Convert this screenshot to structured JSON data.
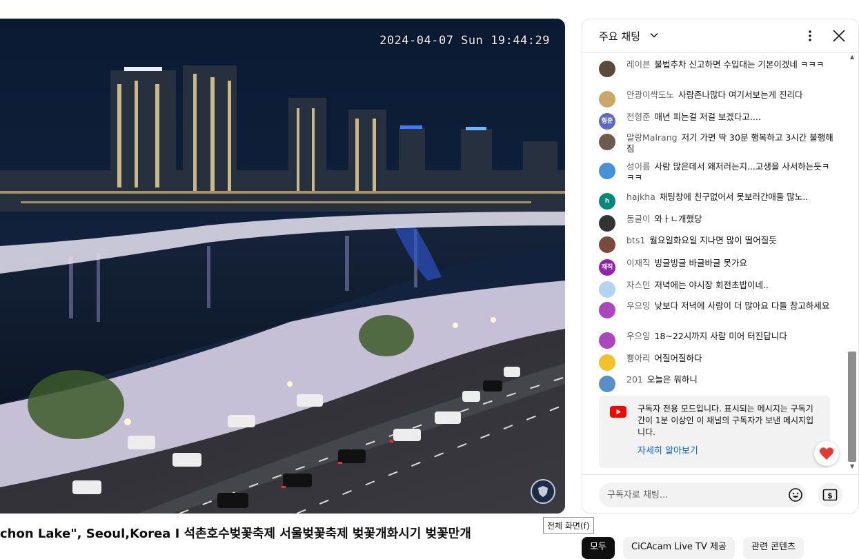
{
  "video": {
    "timestamp": "2024-04-07 Sun 19:44:29",
    "title": "chon Lake\", Seoul,Korea I 석촌호수벚꽃축제 서울벚꽃축제 벚꽃개화시기 벚꽃만개",
    "fullscreen_tooltip": "전체 화면(f)"
  },
  "chat": {
    "header_title": "주요 채팅",
    "messages": [
      {
        "author": "레이븐",
        "text": "불법추차 신고하면 수입대는 기본이겠네 ㅋㅋㅋ",
        "avatar_color": "#5a4a3a",
        "avatar_text": ""
      },
      {
        "author": "안광이싹도노",
        "text": "사람존나많다 여기서보는게 진리다",
        "avatar_color": "#c9a86a",
        "avatar_text": ""
      },
      {
        "author": "전형준",
        "text": "매년 피는걸 저걸 보겠다고....",
        "avatar_color": "#5c6bc0",
        "avatar_text": "형준"
      },
      {
        "author": "말랑Malrang",
        "text": "저기 가면 딱 30분 행복하고 3시간 불행해짐",
        "avatar_color": "#6b5a4e",
        "avatar_text": ""
      },
      {
        "author": "성이름",
        "text": "사람 많은데서 왜저러는지...고생을 사서하는듯ㅋㅋㅋ",
        "avatar_color": "#4a90d9",
        "avatar_text": ""
      },
      {
        "author": "hajkha",
        "text": "채팅창에 친구없어서 못보러간애들 많노..",
        "avatar_color": "#00897b",
        "avatar_text": "h"
      },
      {
        "author": "동글이",
        "text": "와ㅏㄴ개했당",
        "avatar_color": "#333333",
        "avatar_text": ""
      },
      {
        "author": "bts1",
        "text": "월요일화요일 지나면 많이 떨어질듯",
        "avatar_color": "#7a4a3a",
        "avatar_text": ""
      },
      {
        "author": "이재직",
        "text": "빙글빙글 바글바글 못가요",
        "avatar_color": "#8e24aa",
        "avatar_text": "재직"
      },
      {
        "author": "자스민",
        "text": "저녁에는 야시장 회전초밥이네..",
        "avatar_color": "#b3d4f0",
        "avatar_text": ""
      },
      {
        "author": "우으잉",
        "text": "낮보다 저녁에 사람이 더 많아요 다들 참고하세요",
        "avatar_color": "#ab47bc",
        "avatar_text": ""
      },
      {
        "author": "우으잉",
        "text": "18~22시까지 사람 미어 터진답니다",
        "avatar_color": "#ab47bc",
        "avatar_text": ""
      },
      {
        "author": "뿅아리",
        "text": "어질어질하다",
        "avatar_color": "#f2c12e",
        "avatar_text": ""
      },
      {
        "author": "201",
        "text": "오늘은 뭐하니",
        "avatar_color": "#5a8ec9",
        "avatar_text": ""
      }
    ],
    "notice_text": "구독자 전용 모드입니다. 표시되는 메시지는 구독기간이 1분 이상인 이 채널의 구독자가 보낸 메시지입니다.",
    "notice_link": "자세히 알아보기",
    "input_placeholder": "구독자로 채팅..."
  },
  "chips": [
    {
      "label": "모두",
      "active": true
    },
    {
      "label": "CiCAcam Live TV 제공",
      "active": false
    },
    {
      "label": "관련 콘텐츠",
      "active": false
    }
  ],
  "colors": {
    "link": "#065fd4",
    "heart": "#e53935",
    "youtube_red": "#ff0000"
  }
}
